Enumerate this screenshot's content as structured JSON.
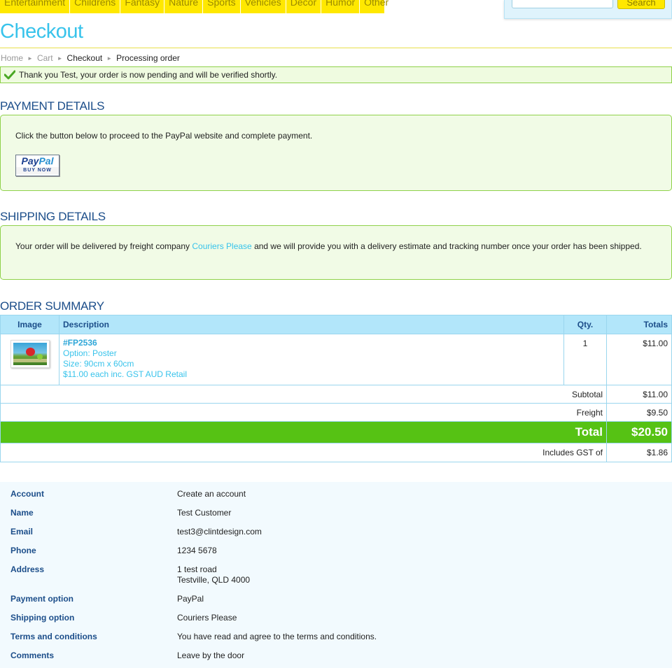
{
  "nav": {
    "items": [
      "Entertainment",
      "Childrens",
      "Fantasy",
      "Nature",
      "Sports",
      "Vehicles",
      "Decor",
      "Humor",
      "Other"
    ],
    "search_placeholder": "",
    "search_label": "Search"
  },
  "page": {
    "title": "Checkout"
  },
  "breadcrumb": {
    "home": "Home",
    "cart": "Cart",
    "checkout": "Checkout",
    "current": "Processing order"
  },
  "notice": {
    "text": "Thank you Test, your order is now pending and will be verified shortly."
  },
  "payment": {
    "heading": "PAYMENT DETAILS",
    "text": "Click the button below to proceed to the PayPal website and complete payment.",
    "button_pay": "Pay",
    "button_pal": "Pal",
    "button_sub": "BUY NOW"
  },
  "shipping": {
    "heading": "SHIPPING DETAILS",
    "text_before": "Your order will be delivered by freight company ",
    "link": "Couriers Please",
    "text_after": " and we will provide you with a delivery estimate and tracking number once your order has been shipped."
  },
  "summary": {
    "heading": "ORDER SUMMARY",
    "columns": {
      "image": "Image",
      "description": "Description",
      "qty": "Qty.",
      "totals": "Totals"
    },
    "item": {
      "code": "#FP2536",
      "option": "Option: Poster",
      "size": "Size: 90cm x 60cm",
      "price": "$11.00 each inc. GST AUD Retail",
      "qty": "1",
      "total": "$11.00"
    },
    "subtotal_label": "Subtotal",
    "subtotal": "$11.00",
    "freight_label": "Freight",
    "freight": "$9.50",
    "total_label": "Total",
    "total": "$20.50",
    "gst_label": "Includes GST of",
    "gst": "$1.86"
  },
  "details": {
    "account_label": "Account",
    "account": "Create an account",
    "name_label": "Name",
    "name": "Test Customer",
    "email_label": "Email",
    "email": "test3@clintdesign.com",
    "phone_label": "Phone",
    "phone": "1234 5678",
    "address_label": "Address",
    "address_line1": "1 test road",
    "address_line2": "Testville, QLD 4000",
    "payment_label": "Payment option",
    "payment": "PayPal",
    "shipping_label": "Shipping option",
    "shipping": "Couriers Please",
    "terms_label": "Terms and conditions",
    "terms": "You have read and agree to the terms and conditions.",
    "comments_label": "Comments",
    "comments": "Leave by the door"
  },
  "colors": {
    "accent_blue": "#38c3eb",
    "heading_navy": "#1c4e8a",
    "nav_yellow": "#ffe800",
    "total_green": "#56c214",
    "notice_border": "#8fd14a"
  }
}
